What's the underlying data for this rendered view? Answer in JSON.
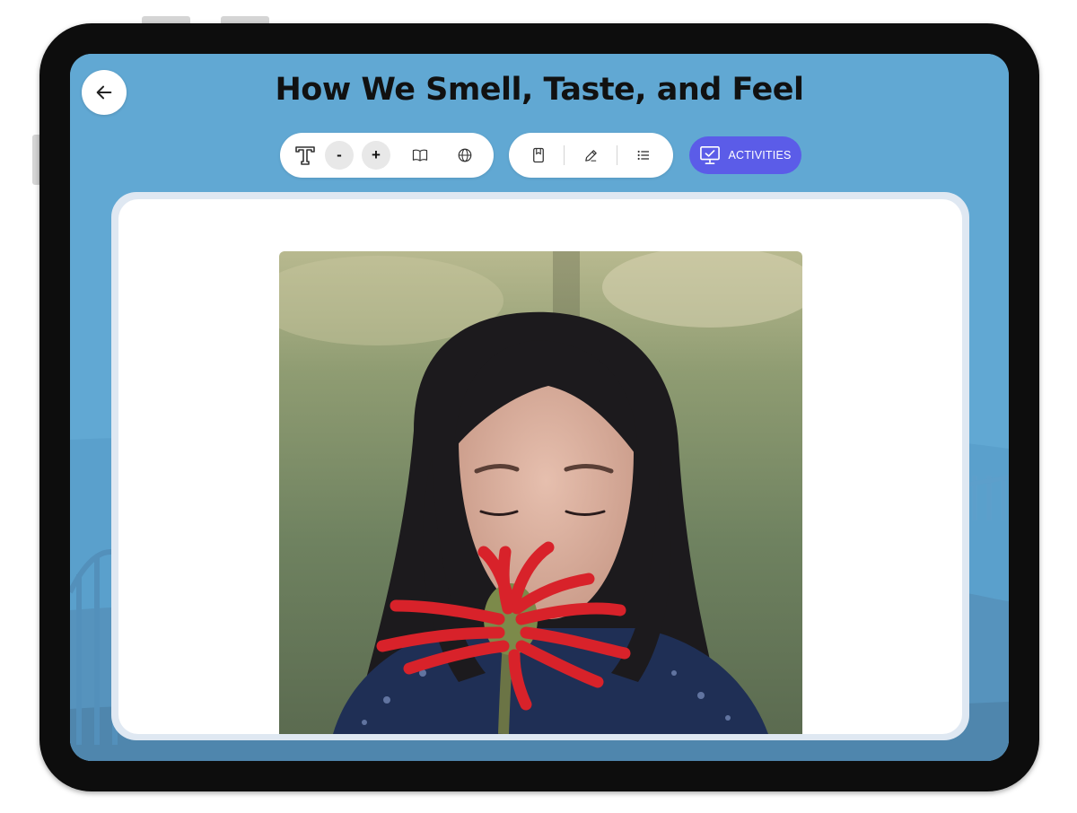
{
  "page": {
    "title": "How We Smell, Taste, and Feel"
  },
  "toolbar": {
    "text_size_icon": "text-size-icon",
    "decrease_label": "-",
    "increase_label": "+",
    "reader_icon": "open-book-icon",
    "language_icon": "globe-icon",
    "bookmark_icon": "bookmark-icon",
    "annotate_icon": "pencil-icon",
    "contents_icon": "list-icon",
    "activities_label": "ACTIVITIES",
    "activities_icon": "monitor-check-icon"
  },
  "navigation": {
    "back_icon": "arrow-left-icon"
  },
  "content": {
    "image_subject": "girl-smelling-red-flower-photo"
  },
  "colors": {
    "screen_background": "#61a8d3",
    "activities_button": "#5b5ce8",
    "title_text": "#111111",
    "card_background": "#ffffff"
  }
}
